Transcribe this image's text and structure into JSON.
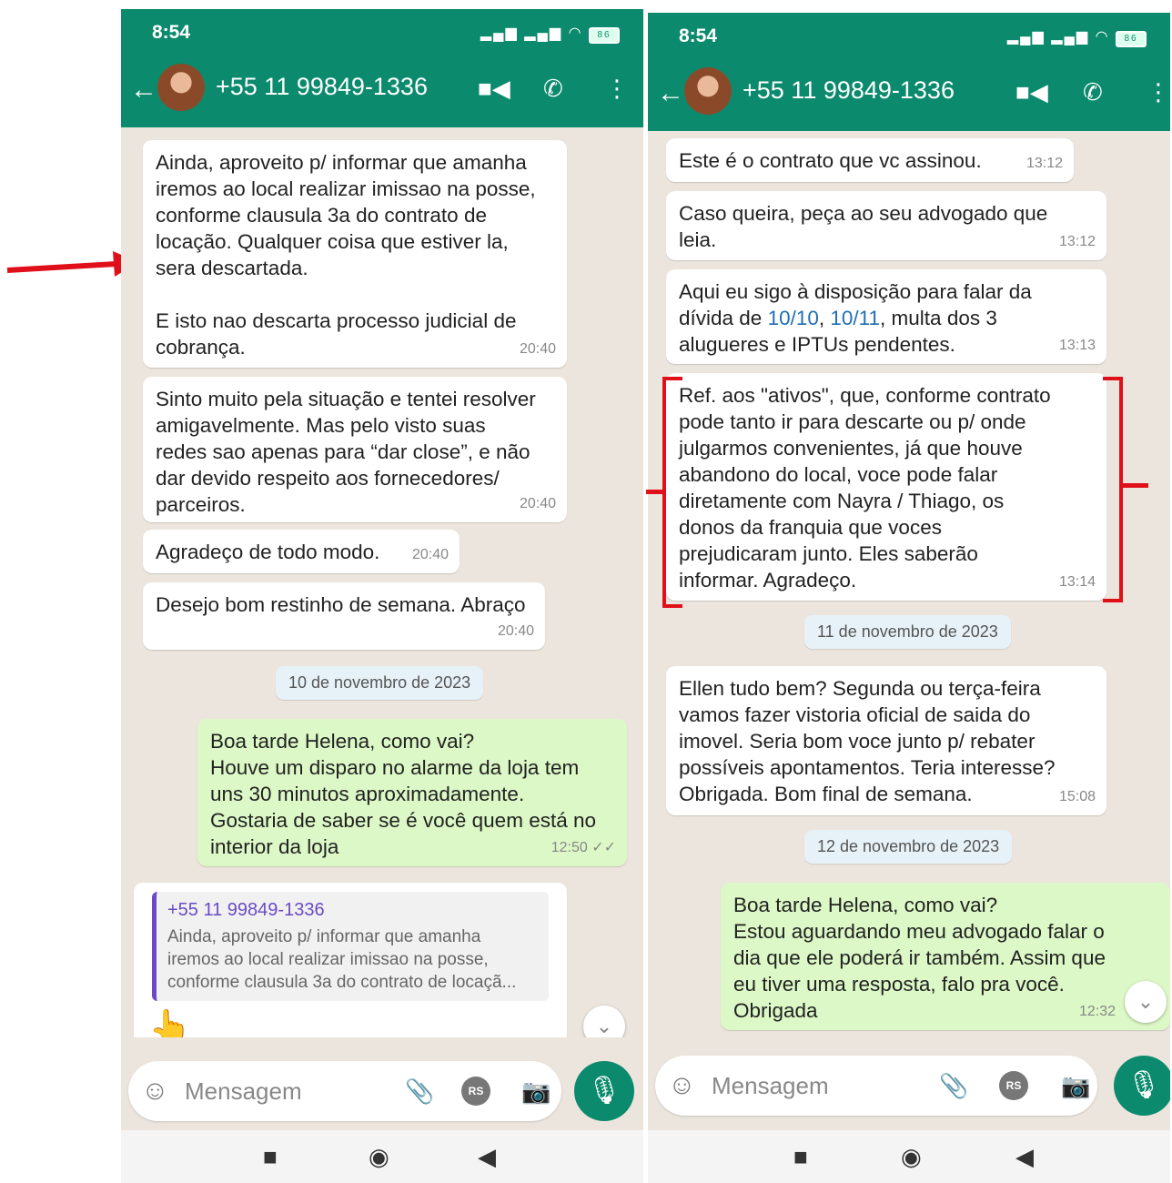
{
  "screens": [
    {
      "status": {
        "time": "8:54",
        "battery": "86"
      },
      "header": {
        "contact": "+55 11 99849-1336"
      },
      "messages": [
        {
          "text": "Ainda, aproveito p/ informar que amanha\niremos ao local realizar imissao na posse,\nconforme clausula 3a do contrato de\nlocação. Qualquer coisa que estiver la,\nsera descartada.\n\nE isto nao descarta processo judicial de\ncobrança.",
          "time": "20:40"
        },
        {
          "text": "Sinto muito pela situação e tentei resolver\namigavelmente. Mas pelo visto suas\nredes sao apenas para “dar close”, e não\ndar devido respeito aos fornecedores/\nparceiros.",
          "time": "20:40"
        },
        {
          "text": "Agradeço de todo modo.",
          "time": "20:40"
        },
        {
          "text": "Desejo bom restinho de semana. Abraço",
          "time": "20:40"
        }
      ],
      "date": "10 de novembro de 2023",
      "outgoing": {
        "text": "Boa tarde Helena, como vai?\nHouve um disparo no alarme da loja tem\nuns 30 minutos aproximadamente.\nGostaria de saber se é você quem está no\ninterior da loja",
        "time": "12:50 ✓✓"
      },
      "quote": {
        "name": "+55 11 99849-1336",
        "text": "Ainda, aproveito p/ informar que amanha\niremos ao local realizar imissao na posse,\nconforme clausula 3a do contrato de locaçã..."
      },
      "input_placeholder": "Mensagem"
    },
    {
      "status": {
        "time": "8:54",
        "battery": "86"
      },
      "header": {
        "contact": "+55 11 99849-1336"
      },
      "messages": [
        {
          "text": "Este é o contrato que vc assinou.",
          "time": "13:12"
        },
        {
          "text": "Caso queira, peça ao seu advogado que\nleia.",
          "time": "13:12"
        },
        {
          "text_a": "Aqui eu sigo à disposição para falar da\ndívida de ",
          "link1": "10/10",
          "sep": ", ",
          "link2": "10/11",
          "text_b": ", multa dos 3\naluguеres e IPTUs pendentes.",
          "time": "13:13"
        },
        {
          "text": "Ref. aos \"ativos\", que, conforme contrato\npode tanto ir para descarte ou p/ onde\njulgarmos convenientes, já que houve\nabandono do local, voce pode falar\ndiretamente com Nayra / Thiago, os\ndonos da franquia que voces\nprejudicaram junto. Eles saberão\ninformar. Agradeço.",
          "time": "13:14"
        }
      ],
      "date1": "11 de novembro de 2023",
      "msg_after": {
        "text": "Ellen tudo bem? Segunda ou terça-feira\nvamos fazer vistoria oficial de saida do\nimovel. Seria bom voce junto p/ rebater\npossíveis apontamentos. Teria interesse?\nObrigada. Bom final de semana.",
        "time": "15:08"
      },
      "date2": "12 de novembro de 2023",
      "outgoing": {
        "text": "Boa tarde Helena, como vai?\nEstou aguardando meu advogado falar o\ndia que ele poderá ir também. Assim que\neu tiver uma resposta, falo pra você.\nObrigada",
        "time": "12:32"
      },
      "input_placeholder": "Mensagem"
    }
  ],
  "icons": {
    "rs_badge": "RS"
  },
  "colors": {
    "header": "#0b8a6d",
    "annotation": "#e0101a",
    "outgoing_bubble": "#dcf8c6"
  }
}
